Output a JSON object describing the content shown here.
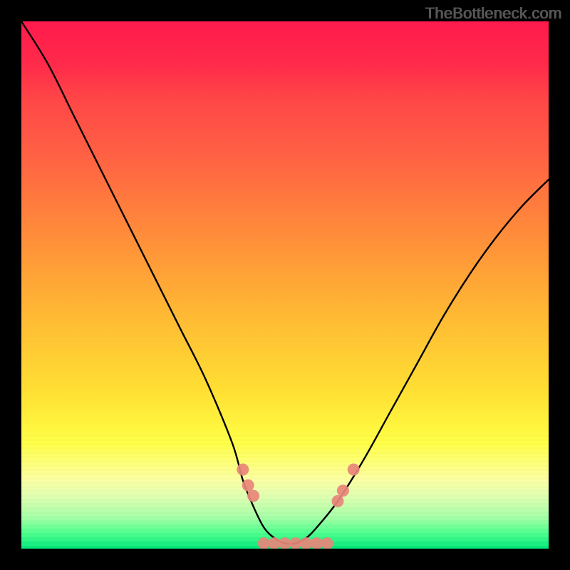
{
  "watermark": {
    "text": "TheBottleneck.com"
  },
  "colors": {
    "gradient_top": "#ff1a4d",
    "gradient_mid": "#ffdf33",
    "gradient_bottom": "#00e879",
    "curve_stroke": "#000000",
    "point_fill": "#e88579"
  },
  "chart_data": {
    "type": "line",
    "title": "",
    "xlabel": "",
    "ylabel": "",
    "xlim": [
      0,
      100
    ],
    "ylim": [
      0,
      100
    ],
    "annotations": [],
    "series": [
      {
        "name": "bottleneck-curve",
        "x": [
          0,
          5,
          10,
          15,
          20,
          25,
          30,
          35,
          40,
          42,
          44,
          46,
          48,
          50,
          52,
          54,
          56,
          60,
          65,
          70,
          75,
          80,
          85,
          90,
          95,
          100
        ],
        "y": [
          100,
          92,
          82,
          72,
          62,
          52,
          42,
          32,
          20,
          13,
          8,
          4,
          2,
          1,
          1,
          2,
          4,
          9,
          17,
          26,
          35,
          44,
          52,
          59,
          65,
          70
        ]
      }
    ],
    "points": [
      {
        "x": 42,
        "y": 15
      },
      {
        "x": 43,
        "y": 12
      },
      {
        "x": 44,
        "y": 10
      },
      {
        "x": 46,
        "y": 1
      },
      {
        "x": 48,
        "y": 1
      },
      {
        "x": 50,
        "y": 1
      },
      {
        "x": 52,
        "y": 1
      },
      {
        "x": 54,
        "y": 1
      },
      {
        "x": 56,
        "y": 1
      },
      {
        "x": 58,
        "y": 1
      },
      {
        "x": 60,
        "y": 9
      },
      {
        "x": 61,
        "y": 11
      },
      {
        "x": 63,
        "y": 15
      }
    ]
  }
}
